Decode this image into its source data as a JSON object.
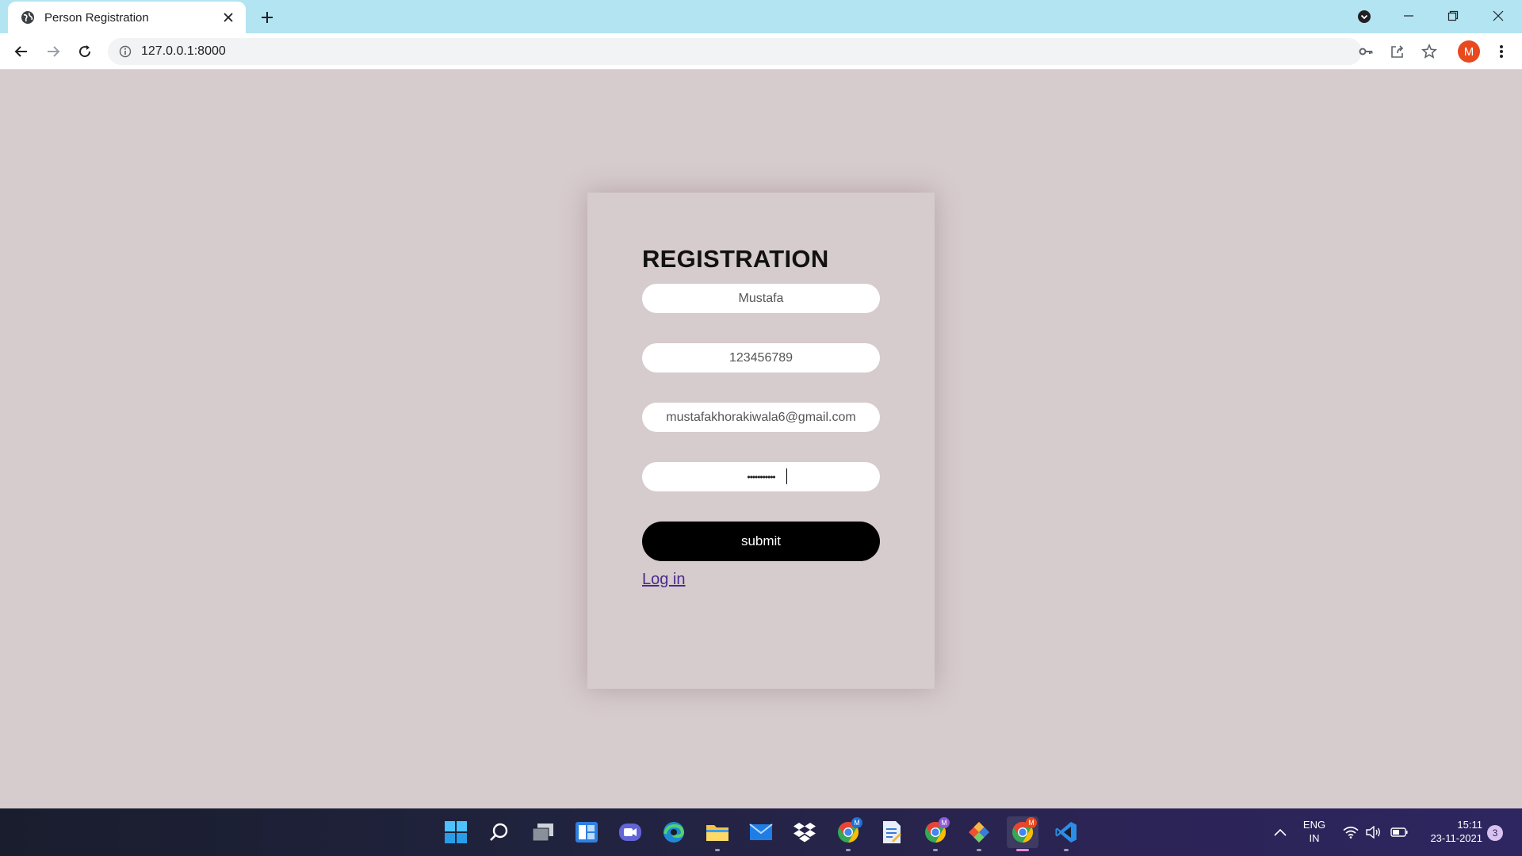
{
  "browser": {
    "tab_title": "Person Registration",
    "url": "127.0.0.1:8000",
    "profile_initial": "M",
    "icons": [
      "globe-icon",
      "close-icon",
      "plus-icon",
      "tab-search-icon",
      "minimize-icon",
      "restore-icon",
      "back-icon",
      "forward-icon",
      "reload-icon",
      "info-icon",
      "key-icon",
      "share-icon",
      "star-icon",
      "more-icon"
    ]
  },
  "form": {
    "title": "REGISTRATION",
    "name_value": "Mustafa",
    "phone_value": "123456789",
    "email_value": "mustafakhorakiwala6@gmail.com",
    "password_value": "•••••••••••",
    "submit_label": "submit",
    "login_link": "Log in"
  },
  "taskbar": {
    "apps": [
      "windows-start-icon",
      "search-icon",
      "task-view-icon",
      "widgets-icon",
      "chat-icon",
      "edge-icon",
      "file-explorer-icon",
      "mail-icon",
      "dropbox-icon",
      "chrome-icon",
      "notepad-icon",
      "chrome-profile-icon",
      "git-icon",
      "chrome-active-icon",
      "vscode-icon"
    ],
    "lang_line1": "ENG",
    "lang_line2": "IN",
    "time": "15:11",
    "date": "23-11-2021",
    "notification_count": "3",
    "badge_letter": "M"
  },
  "colors": {
    "page_bg": "#d6cbcd",
    "tab_strip": "#b3e4f2",
    "button_bg": "#000000",
    "link": "#4b2a8c",
    "avatar": "#e8491e"
  }
}
